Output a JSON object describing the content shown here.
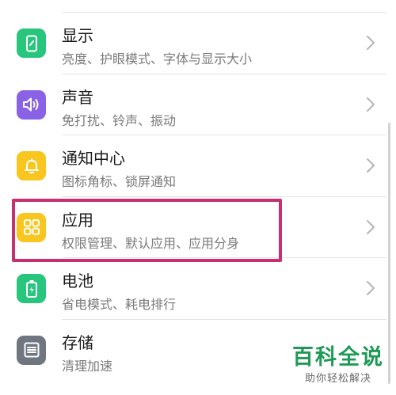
{
  "settings": {
    "items": [
      {
        "title": "显示",
        "subtitle": "亮度、护眼模式、字体与显示大小",
        "icon": "display-icon",
        "color": "#28c57d"
      },
      {
        "title": "声音",
        "subtitle": "免打扰、铃声、振动",
        "icon": "sound-icon",
        "color": "#8a62e6"
      },
      {
        "title": "通知中心",
        "subtitle": "图标角标、锁屏通知",
        "icon": "bell-icon",
        "color": "#f8c61f"
      },
      {
        "title": "应用",
        "subtitle": "权限管理、默认应用、应用分身",
        "icon": "apps-grid-icon",
        "color": "#f8c61f"
      },
      {
        "title": "电池",
        "subtitle": "省电模式、耗电排行",
        "icon": "battery-icon",
        "color": "#28c57d"
      },
      {
        "title": "存储",
        "subtitle": "清理加速",
        "icon": "storage-icon",
        "color": "#6f7680"
      }
    ]
  },
  "highlight_color": "#c7306f",
  "watermark": {
    "title": "百科全说",
    "subtitle": "助你轻松解决",
    "color": "#1f9a55"
  }
}
